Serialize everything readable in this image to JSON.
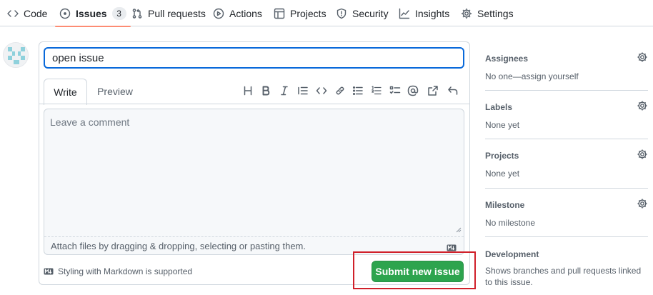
{
  "nav": {
    "tabs": [
      {
        "label": "Code",
        "icon": "code-icon"
      },
      {
        "label": "Issues",
        "icon": "issue-opened-icon",
        "count": "3",
        "active": true
      },
      {
        "label": "Pull requests",
        "icon": "git-pull-request-icon"
      },
      {
        "label": "Actions",
        "icon": "play-icon"
      },
      {
        "label": "Projects",
        "icon": "table-icon"
      },
      {
        "label": "Security",
        "icon": "shield-icon"
      },
      {
        "label": "Insights",
        "icon": "graph-icon"
      },
      {
        "label": "Settings",
        "icon": "gear-icon"
      }
    ]
  },
  "issue_form": {
    "title_value": "open issue",
    "tabs": {
      "write": "Write",
      "preview": "Preview"
    },
    "toolbar_icons": [
      "heading-icon",
      "bold-icon",
      "italic-icon",
      "quote-icon",
      "code-icon",
      "link-icon",
      "unordered-list-icon",
      "ordered-list-icon",
      "task-list-icon",
      "mention-icon",
      "cross-reference-icon",
      "undo-icon"
    ],
    "comment_placeholder": "Leave a comment",
    "attach_text": "Attach files by dragging & dropping, selecting or pasting them.",
    "markdown_hint": "Styling with Markdown is supported",
    "submit_label": "Submit new issue"
  },
  "sidebar": {
    "assignees": {
      "title": "Assignees",
      "value": "No one—assign yourself"
    },
    "labels": {
      "title": "Labels",
      "value": "None yet"
    },
    "projects": {
      "title": "Projects",
      "value": "None yet"
    },
    "milestone": {
      "title": "Milestone",
      "value": "No milestone"
    },
    "development": {
      "title": "Development",
      "value": "Shows branches and pull requests linked to this issue."
    }
  },
  "colors": {
    "accent_blue": "#0969da",
    "submit_green": "#2da44e",
    "active_tab_underline": "#fd8c73",
    "highlight_red": "#d0202a"
  }
}
